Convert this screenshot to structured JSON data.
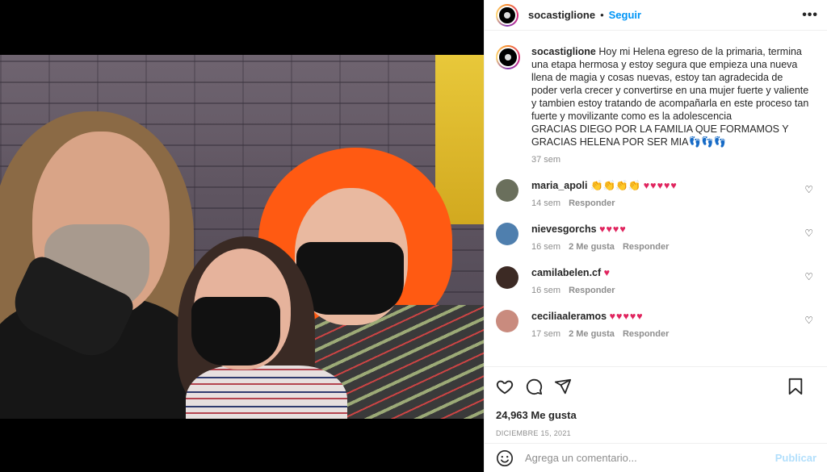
{
  "post": {
    "username": "socastiglione",
    "follow_label": "Seguir",
    "more_label": "•••",
    "caption": {
      "username": "socastiglione",
      "text": "Hoy mi Helena egreso de la primaria, termina una etapa hermosa y estoy segura que empieza una nueva llena de magia y cosas nuevas, estoy tan agradecida de poder verla crecer y convertirse en una mujer fuerte y valiente y tambien estoy tratando de acompañarla en este proceso tan fuerte y movilizante como es la adolescencia",
      "text2": "GRACIAS DIEGO POR LA FAMILIA QUE FORMAMOS Y GRACIAS HELENA POR SER MIA👣👣👣",
      "time": "37 sem"
    },
    "comments": [
      {
        "username": "maria_apoli",
        "emoji": "👏👏👏👏",
        "hearts": "♥♥♥♥♥",
        "time": "14 sem",
        "likes": "",
        "reply": "Responder",
        "color": "#6a6f5c"
      },
      {
        "username": "nievesgorchs",
        "emoji": "",
        "hearts": "♥♥♥♥",
        "time": "16 sem",
        "likes": "2 Me gusta",
        "reply": "Responder",
        "color": "#4f7fae"
      },
      {
        "username": "camilabelen.cf",
        "emoji": "",
        "hearts": "♥",
        "time": "16 sem",
        "likes": "",
        "reply": "Responder",
        "color": "#3c2a24"
      },
      {
        "username": "ceciliaaleramos",
        "emoji": "",
        "hearts": "♥♥♥♥♥",
        "time": "17 sem",
        "likes": "2 Me gusta",
        "reply": "Responder",
        "color": "#c98b7e"
      }
    ],
    "likes": "24,963 Me gusta",
    "date": "DICIEMBRE 15, 2021",
    "add_comment_placeholder": "Agrega un comentario...",
    "publish_label": "Publicar"
  }
}
